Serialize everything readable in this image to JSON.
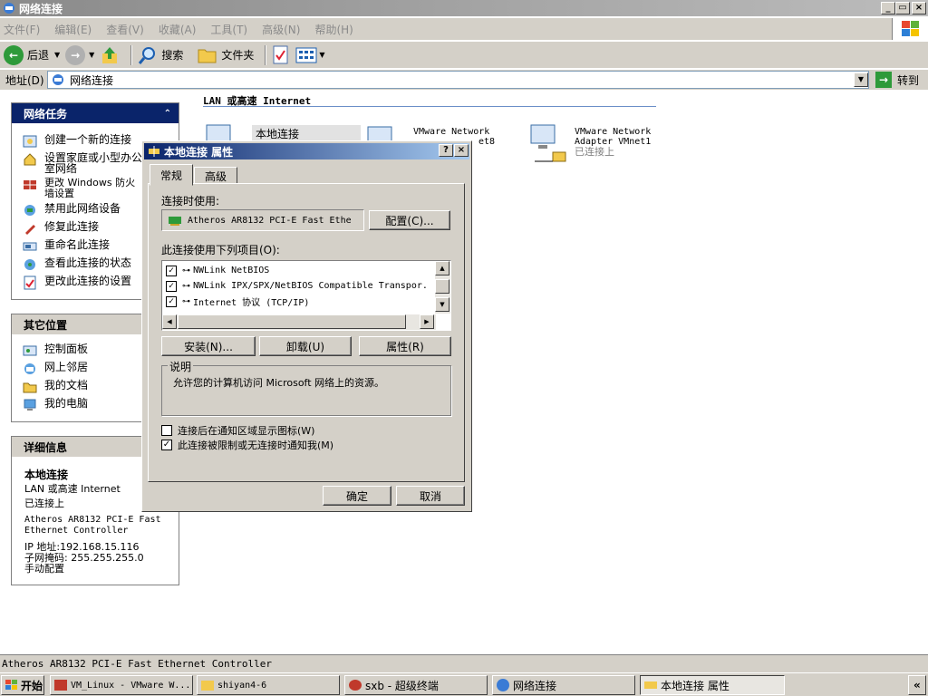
{
  "window": {
    "title": "网络连接",
    "controls": {
      "minimize": "_",
      "maximize": "▭",
      "close": "×"
    }
  },
  "menu": [
    "文件(F)",
    "编辑(E)",
    "查看(V)",
    "收藏(A)",
    "工具(T)",
    "高级(N)",
    "帮助(H)"
  ],
  "toolbar": {
    "back": "后退",
    "search": "搜索",
    "folders": "文件夹"
  },
  "address": {
    "label": "地址(D)",
    "value": "网络连接",
    "go": "转到"
  },
  "tasks_pane": {
    "title": "网络任务",
    "items": [
      "创建一个新的连接",
      "设置家庭或小型办公室网络",
      "更改 Windows 防火墙设置",
      "禁用此网络设备",
      "修复此连接",
      "重命名此连接",
      "查看此连接的状态",
      "更改此连接的设置"
    ]
  },
  "other_places": {
    "title": "其它位置",
    "items": [
      "控制面板",
      "网上邻居",
      "我的文档",
      "我的电脑"
    ]
  },
  "details": {
    "title": "详细信息",
    "name": "本地连接",
    "type": "LAN 或高速 Internet",
    "status": "已连接上",
    "adapter": "Atheros AR8132 PCI-E Fast Ethernet Controller",
    "ip": "IP 地址:192.168.15.116",
    "mask": "子网掩码: 255.255.255.0",
    "config": "手动配置"
  },
  "main": {
    "section": "LAN 或高速 Internet",
    "connections": [
      {
        "name": "本地连接",
        "line2": ""
      },
      {
        "name": "VMware Network",
        "line2": "et8"
      },
      {
        "name": "VMware Network",
        "line2": "Adapter VMnet1",
        "status": "已连接上"
      }
    ]
  },
  "dialog": {
    "title": "本地连接 属性",
    "help": "?",
    "close": "×",
    "tabs": [
      "常规",
      "高级"
    ],
    "connect_using_label": "连接时使用:",
    "adapter": "Atheros AR8132 PCI-E Fast Ethe",
    "configure": "配置(C)...",
    "items_label": "此连接使用下列项目(O):",
    "items": [
      {
        "label": "NWLink NetBIOS",
        "checked": true
      },
      {
        "label": "NWLink IPX/SPX/NetBIOS Compatible Transpor.",
        "checked": true
      },
      {
        "label": "Internet 协议 (TCP/IP)",
        "checked": true
      }
    ],
    "install": "安装(N)...",
    "uninstall": "卸载(U)",
    "properties": "属性(R)",
    "description_label": "说明",
    "description": "允许您的计算机访问 Microsoft 网络上的资源。",
    "option1": "连接后在通知区域显示图标(W)",
    "option1_checked": false,
    "option2": "此连接被限制或无连接时通知我(M)",
    "option2_checked": true,
    "ok": "确定",
    "cancel": "取消"
  },
  "statusbar": "Atheros AR8132 PCI-E Fast Ethernet Controller",
  "taskbar": {
    "start": "开始",
    "buttons": [
      "VM_Linux - VMware W...",
      "shiyan4-6",
      "sxb - 超级终端",
      "网络连接",
      "本地连接 属性"
    ],
    "tray_toggle": "«"
  }
}
